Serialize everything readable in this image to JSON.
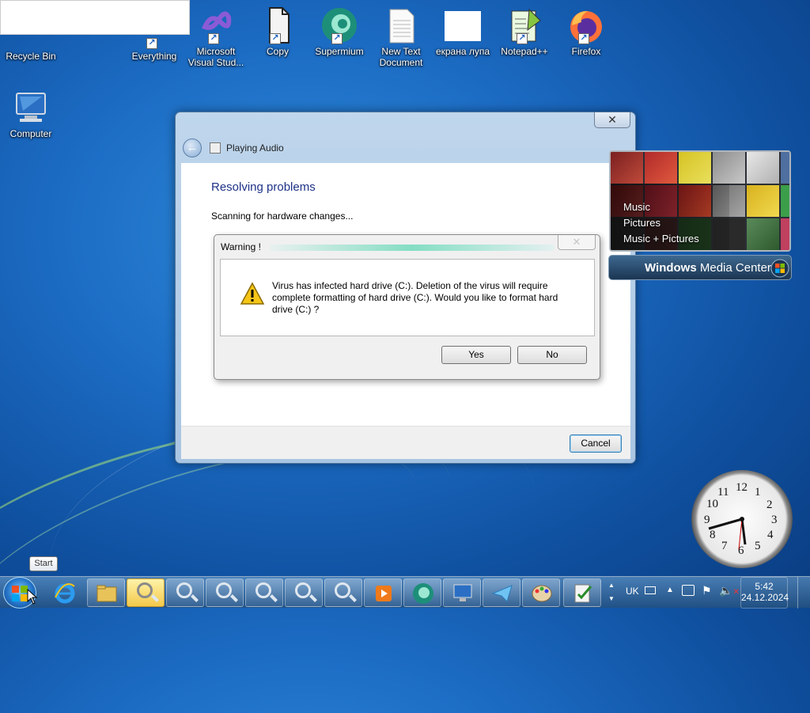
{
  "desktop_icons": [
    {
      "label": "Recycle Bin"
    },
    {
      "label": "Everything"
    },
    {
      "label": "Microsoft Visual Stud..."
    },
    {
      "label": "Copy"
    },
    {
      "label": "Supermium"
    },
    {
      "label": "New Text Document"
    },
    {
      "label": "екрана лупа"
    },
    {
      "label": "Notepad++"
    },
    {
      "label": "Firefox"
    },
    {
      "label": "Computer"
    }
  ],
  "dialog": {
    "title": "Playing Audio",
    "close_label": "✕",
    "heading": "Resolving problems",
    "status": "Scanning for hardware changes...",
    "cancel_label": "Cancel"
  },
  "warning": {
    "title": "Warning !",
    "close_label": "✕",
    "message": "Virus has infected hard drive (C:). Deletion of the virus will require complete formatting of hard drive (C:). Would you like to format hard drive (C:) ?",
    "yes_label": "Yes",
    "no_label": "No"
  },
  "media_center": {
    "items": [
      "Music",
      "Pictures",
      "Music + Pictures"
    ],
    "brand_bold": "Windows",
    "brand_rest": " Media Center"
  },
  "desktop_clock": {
    "numbers": [
      "12",
      "1",
      "2",
      "3",
      "4",
      "5",
      "6",
      "7",
      "8",
      "9",
      "10",
      "11"
    ]
  },
  "taskbar": {
    "start_tooltip": "Start",
    "language": "UK",
    "time": "5:42",
    "date": "24.12.2024"
  }
}
